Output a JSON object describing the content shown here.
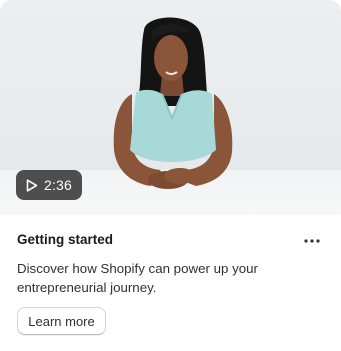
{
  "card": {
    "video": {
      "duration": "2:36",
      "play_icon": "play-icon"
    },
    "title": "Getting started",
    "menu_icon": "more-horizontal-icon",
    "description": "Discover how Shopify can power up your entrepreneurial journey.",
    "cta_label": "Learn more"
  }
}
